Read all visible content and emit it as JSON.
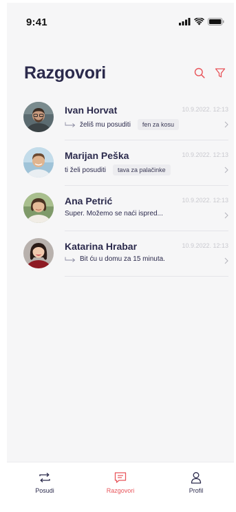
{
  "status_bar": {
    "time": "9:41"
  },
  "header": {
    "title": "Razgovori",
    "icons": [
      "search-icon",
      "filter-icon"
    ],
    "accent_color": "#e8545a"
  },
  "conversations": [
    {
      "name": "Ivan Horvat",
      "time": "10.9.2022. 12:13",
      "reply_arrow": true,
      "preview": "želiš mu posuditi",
      "tag": "fen za kosu"
    },
    {
      "name": "Marijan Peška",
      "time": "10.9.2022. 12:13",
      "reply_arrow": false,
      "preview": "ti želi posuditi",
      "tag": "tava za palačinke"
    },
    {
      "name": "Ana Petrić",
      "time": "10.9.2022. 12:13",
      "reply_arrow": false,
      "preview": "Super. Možemo se naći ispred...",
      "tag": ""
    },
    {
      "name": "Katarina Hrabar",
      "time": "10.9.2022. 12:13",
      "reply_arrow": true,
      "preview": "Bit ću u domu za 15 minuta.",
      "tag": ""
    }
  ],
  "tab_bar": {
    "tabs": [
      {
        "label": "Posudi",
        "icon": "swap-arrows-icon",
        "active": false
      },
      {
        "label": "Razgovori",
        "icon": "chat-icon",
        "active": true
      },
      {
        "label": "Profil",
        "icon": "user-icon",
        "active": false
      }
    ]
  }
}
